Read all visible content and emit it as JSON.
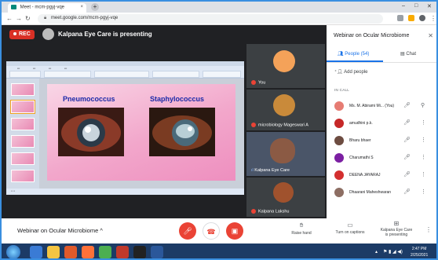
{
  "browser": {
    "tab_title": "Meet - mcm-pgyj-vqe",
    "close_glyph": "×",
    "new_tab_glyph": "+",
    "url": "meet.google.com/mcm-pgyj-vqe"
  },
  "meet": {
    "rec_label": "REC",
    "presenting_text": "Kalpana Eye Care is presenting"
  },
  "slide": {
    "label_left": "Pneumococcus",
    "label_right": "Staphylococcus"
  },
  "tiles": [
    {
      "name": "You"
    },
    {
      "name": "microbiology Mageswari A"
    },
    {
      "name": "Kalpana Eye Care"
    },
    {
      "name": "Kalpana Lakshu"
    }
  ],
  "panel": {
    "title": "Webinar on Ocular Microbiome",
    "tab_people": "People (54)",
    "tab_chat": "Chat",
    "add_people": "Add people",
    "in_call": "IN CALL",
    "people": [
      {
        "name": "Ms. M. Abirami Mi... (You)",
        "color": "#e67c73"
      },
      {
        "name": "amudhini p.k.",
        "color": "#c62828"
      },
      {
        "name": "Bharu bhaer",
        "color": "#6d4c41"
      },
      {
        "name": "Charumathi S",
        "color": "#7b1fa2"
      },
      {
        "name": "DEENA JAYARAJ",
        "color": "#d32f2f"
      },
      {
        "name": "Dhaarani Maheshwaran",
        "color": "#8d6e63"
      }
    ]
  },
  "bottombar": {
    "meeting_name": "Webinar on Ocular Microbiome",
    "raise_hand": "Raise hand",
    "turn_on_captions": "Turn on captions",
    "presenting_line1": "Kalpana Eye Care",
    "presenting_line2": "is presenting"
  },
  "taskbar": {
    "time": "2:47 PM",
    "date": "2/25/2021"
  },
  "colors": {
    "accent": "#1a73e8",
    "rec": "#d93025",
    "end_call": "#ea4335"
  }
}
